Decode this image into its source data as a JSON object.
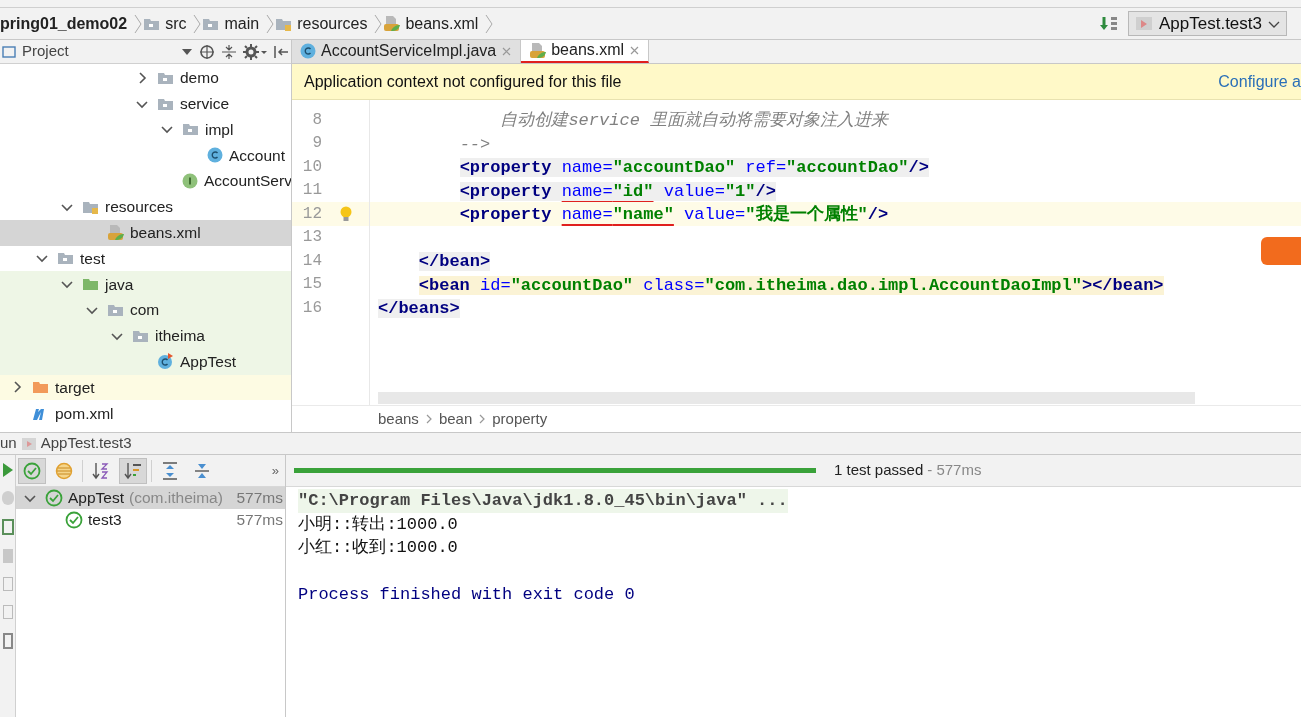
{
  "navbar": {
    "breadcrumbs": [
      {
        "label": "pring01_demo02",
        "kind": "module"
      },
      {
        "label": "src",
        "kind": "folder"
      },
      {
        "label": "main",
        "kind": "folder"
      },
      {
        "label": "resources",
        "kind": "resources-folder"
      },
      {
        "label": "beans.xml",
        "kind": "xml"
      }
    ],
    "run_config": {
      "label": "AppTest.test3"
    }
  },
  "project_panel": {
    "title": "Project",
    "tree": [
      {
        "children": [
          {
            "children": [
              {
                "children": [
                  {
                    "children": [
                      {
                        "children": [
                          {
                            "label": "demo",
                            "kind": "folder",
                            "expanded": false,
                            "selected": false,
                            "test_source": false,
                            "excluded": false
                          },
                          {
                            "label": "service",
                            "kind": "folder",
                            "expanded": true,
                            "selected": false,
                            "test_source": false,
                            "excluded": false,
                            "children": [
                              {
                                "label": "impl",
                                "kind": "folder",
                                "expanded": true,
                                "selected": false,
                                "test_source": false,
                                "excluded": false,
                                "children": [
                                  {
                                    "label": "Account",
                                    "kind": "class",
                                    "selected": false,
                                    "test_source": false,
                                    "excluded": false
                                  }
                                ]
                              },
                              {
                                "label": "AccountServ",
                                "kind": "interface",
                                "selected": false,
                                "test_source": false,
                                "excluded": false
                              }
                            ]
                          }
                        ]
                      }
                    ]
                  }
                ]
              },
              {
                "label": "resources",
                "kind": "resources-folder",
                "expanded": true,
                "selected": false,
                "test_source": false,
                "excluded": false,
                "children": [
                  {
                    "label": "beans.xml",
                    "kind": "xml",
                    "selected": true
                  }
                ]
              }
            ]
          },
          {
            "label": "test",
            "kind": "folder",
            "expanded": true,
            "selected": false,
            "test_source": false,
            "excluded": false,
            "children": [
              {
                "label": "java",
                "kind": "test-folder",
                "expanded": true,
                "selected": false,
                "test_source": true,
                "excluded": false,
                "children": [
                  {
                    "label": "com",
                    "kind": "folder",
                    "expanded": true,
                    "selected": false,
                    "test_source": true,
                    "excluded": false,
                    "children": [
                      {
                        "label": "itheima",
                        "kind": "folder",
                        "expanded": true,
                        "selected": false,
                        "test_source": true,
                        "excluded": false,
                        "children": [
                          {
                            "label": "AppTest",
                            "kind": "test-class",
                            "selected": false,
                            "test_source": true,
                            "excluded": false
                          }
                        ]
                      }
                    ]
                  }
                ]
              }
            ]
          }
        ]
      },
      {
        "label": "target",
        "kind": "excluded-folder",
        "expanded": false,
        "selected": false,
        "excluded": true
      },
      {
        "label": "pom.xml",
        "kind": "maven",
        "selected": false,
        "test_source": false,
        "excluded": false
      }
    ]
  },
  "editor": {
    "tabs": [
      {
        "label": "AccountServiceImpl.java",
        "kind": "class",
        "selected": false,
        "underlined": false
      },
      {
        "label": "beans.xml",
        "kind": "xml",
        "selected": true,
        "underlined": true
      }
    ],
    "notification": {
      "message": "Application context not configured for this file",
      "link": "Configure a"
    },
    "lines": [
      {
        "number": "8",
        "current": false,
        "kind": "plain",
        "tokens": [
          {
            "kind": "comment",
            "text": "            自动创建service 里面就自动将需要对象注入进来"
          }
        ]
      },
      {
        "number": "9",
        "current": false,
        "kind": "plain",
        "tokens": [
          {
            "kind": "comment",
            "text": "        -->"
          }
        ]
      },
      {
        "number": "10",
        "current": false,
        "kind": "tag",
        "tokens": [
          {
            "kind": "tag",
            "text": "        <property "
          },
          {
            "kind": "attr",
            "text": "name="
          },
          {
            "kind": "value",
            "text": "\"accountDao\" "
          },
          {
            "kind": "attr",
            "text": "ref="
          },
          {
            "kind": "value",
            "text": "\"accountDao\""
          },
          {
            "kind": "tag",
            "text": "/>"
          }
        ]
      },
      {
        "number": "11",
        "current": false,
        "kind": "tag",
        "tokens": [
          {
            "kind": "tag",
            "text": "        <property "
          },
          {
            "kind": "attr",
            "text": "name=",
            "underlined": true
          },
          {
            "kind": "value",
            "text": "\"id\"",
            "underlined": true
          },
          {
            "kind": "attr",
            "text": " value="
          },
          {
            "kind": "value",
            "text": "\"1\""
          },
          {
            "kind": "tag",
            "text": "/>"
          }
        ]
      },
      {
        "number": "12",
        "current": true,
        "kind": "plain",
        "bulb": true,
        "tokens": [
          {
            "kind": "tag",
            "text": "        <property "
          },
          {
            "kind": "attr",
            "text": "name=",
            "underlined": true
          },
          {
            "kind": "value",
            "text": "\"name\"",
            "underlined": true
          },
          {
            "kind": "attr",
            "text": " value="
          },
          {
            "kind": "value",
            "text": "\"我是一个属性\""
          },
          {
            "kind": "tag",
            "text": "/>"
          }
        ]
      },
      {
        "number": "13",
        "current": false
      },
      {
        "number": "14",
        "current": false,
        "kind": "tag",
        "tokens": [
          {
            "kind": "tag",
            "text": "    </bean>"
          }
        ]
      },
      {
        "number": "15",
        "current": false,
        "kind": "matched",
        "tokens": [
          {
            "kind": "tag",
            "text": "    <bean "
          },
          {
            "kind": "attr",
            "text": "id="
          },
          {
            "kind": "value",
            "text": "\"accountDao\" "
          },
          {
            "kind": "attr",
            "text": "class="
          },
          {
            "kind": "value",
            "text": "\"com.itheima.dao.impl.AccountDaoImpl\""
          },
          {
            "kind": "tag",
            "text": "></bean>"
          }
        ]
      },
      {
        "number": "16",
        "current": false,
        "kind": "tag",
        "tokens": [
          {
            "kind": "tag",
            "text": "</beans>"
          }
        ]
      }
    ],
    "breadcrumbs": [
      "beans",
      "bean",
      "property"
    ]
  },
  "run_panel": {
    "title": "un",
    "config": "AppTest.test3",
    "toolbar": [
      {
        "kind": "passed",
        "selected": true
      },
      {
        "kind": "ignored",
        "selected": false
      },
      {
        "kind": "sort-alpha",
        "selected": false
      },
      {
        "kind": "sort-duration",
        "selected": true
      },
      {
        "kind": "expand",
        "selected": false
      },
      {
        "kind": "collapse",
        "selected": false
      }
    ],
    "more": "»",
    "status": {
      "summary": "1 test passed",
      "duration": "- 577ms",
      "level": 1
    },
    "tests": [
      {
        "name": "AppTest",
        "package": "(com.itheima)",
        "duration": "577ms",
        "kind": "passed",
        "expanded": true,
        "selected": true,
        "children": [
          {
            "name": "test3",
            "duration": "577ms",
            "kind": "passed",
            "selected": false
          }
        ]
      }
    ],
    "console": [
      {
        "kind": "command",
        "text": "\"C:\\Program Files\\Java\\jdk1.8.0_45\\bin\\java\" ..."
      },
      {
        "kind": "output",
        "text": "小明::转出:1000.0"
      },
      {
        "kind": "output",
        "text": "小红::收到:1000.0"
      },
      {
        "kind": "exit",
        "text": "Process finished with exit code 0"
      }
    ]
  }
}
